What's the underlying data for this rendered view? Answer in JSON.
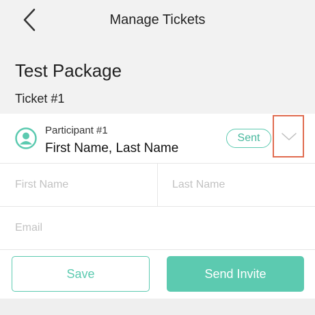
{
  "header": {
    "title": "Manage Tickets"
  },
  "package": {
    "title": "Test Package",
    "ticket_label": "Ticket #1"
  },
  "participant": {
    "label": "Participant #1",
    "name": "First Name, Last Name",
    "status": "Sent"
  },
  "form": {
    "first_name_placeholder": "First Name",
    "last_name_placeholder": "Last Name",
    "email_placeholder": "Email"
  },
  "actions": {
    "save_label": "Save",
    "send_invite_label": "Send Invite"
  },
  "colors": {
    "accent": "#5ccab0",
    "highlight": "#e06a4e",
    "background": "#f2f2f2"
  }
}
